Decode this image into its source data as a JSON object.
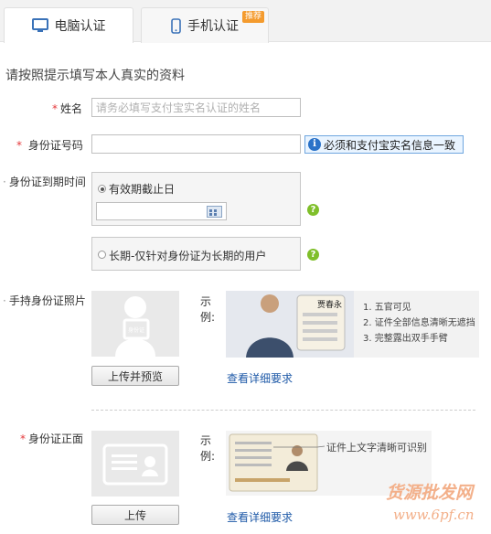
{
  "tabs": [
    {
      "label": "电脑认证",
      "active": true
    },
    {
      "label": "手机认证",
      "active": false,
      "badge": "推荐"
    }
  ],
  "intro": "请按照提示填写本人真实的资料",
  "name_field": {
    "label": "姓名",
    "placeholder": "请务必填写支付宝实名认证的姓名"
  },
  "id_field": {
    "label": "身份证号码",
    "value": "",
    "notice": "必须和支付宝实名信息一致"
  },
  "expiry": {
    "label": "身份证到期时间",
    "option1": "有效期截止日",
    "option2": "长期-仅针对身份证为长期的用户",
    "date_value": ""
  },
  "handheld": {
    "label": "手持身份证照片",
    "example": "示例:",
    "upload_button": "上传并预览",
    "detail_link": "查看详细要求",
    "sample_name_line": "贾春永",
    "checklist": [
      "1. 五官可见",
      "2. 证件全部信息清晰无遮挡",
      "3. 完整露出双手手臂"
    ]
  },
  "front": {
    "label": "身份证正面",
    "example": "示例:",
    "upload_button": "上传",
    "detail_link": "查看详细要求",
    "callout": "证件上文字清晰可识别"
  },
  "watermark": {
    "line1": "货源批发网",
    "line2": "www.6pf.cn"
  },
  "colors": {
    "required": "#e4393c",
    "link": "#1f5aa8",
    "help": "#7fbf2a",
    "notice_border": "#6fa6df"
  }
}
